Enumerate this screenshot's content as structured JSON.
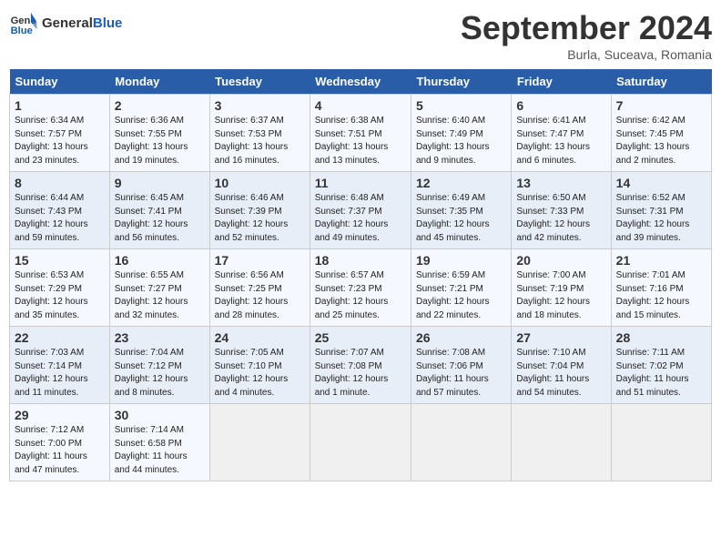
{
  "logo": {
    "text_general": "General",
    "text_blue": "Blue"
  },
  "header": {
    "title": "September 2024",
    "subtitle": "Burla, Suceava, Romania"
  },
  "weekdays": [
    "Sunday",
    "Monday",
    "Tuesday",
    "Wednesday",
    "Thursday",
    "Friday",
    "Saturday"
  ],
  "weeks": [
    [
      {
        "day": "1",
        "info": "Sunrise: 6:34 AM\nSunset: 7:57 PM\nDaylight: 13 hours\nand 23 minutes."
      },
      {
        "day": "2",
        "info": "Sunrise: 6:36 AM\nSunset: 7:55 PM\nDaylight: 13 hours\nand 19 minutes."
      },
      {
        "day": "3",
        "info": "Sunrise: 6:37 AM\nSunset: 7:53 PM\nDaylight: 13 hours\nand 16 minutes."
      },
      {
        "day": "4",
        "info": "Sunrise: 6:38 AM\nSunset: 7:51 PM\nDaylight: 13 hours\nand 13 minutes."
      },
      {
        "day": "5",
        "info": "Sunrise: 6:40 AM\nSunset: 7:49 PM\nDaylight: 13 hours\nand 9 minutes."
      },
      {
        "day": "6",
        "info": "Sunrise: 6:41 AM\nSunset: 7:47 PM\nDaylight: 13 hours\nand 6 minutes."
      },
      {
        "day": "7",
        "info": "Sunrise: 6:42 AM\nSunset: 7:45 PM\nDaylight: 13 hours\nand 2 minutes."
      }
    ],
    [
      {
        "day": "8",
        "info": "Sunrise: 6:44 AM\nSunset: 7:43 PM\nDaylight: 12 hours\nand 59 minutes."
      },
      {
        "day": "9",
        "info": "Sunrise: 6:45 AM\nSunset: 7:41 PM\nDaylight: 12 hours\nand 56 minutes."
      },
      {
        "day": "10",
        "info": "Sunrise: 6:46 AM\nSunset: 7:39 PM\nDaylight: 12 hours\nand 52 minutes."
      },
      {
        "day": "11",
        "info": "Sunrise: 6:48 AM\nSunset: 7:37 PM\nDaylight: 12 hours\nand 49 minutes."
      },
      {
        "day": "12",
        "info": "Sunrise: 6:49 AM\nSunset: 7:35 PM\nDaylight: 12 hours\nand 45 minutes."
      },
      {
        "day": "13",
        "info": "Sunrise: 6:50 AM\nSunset: 7:33 PM\nDaylight: 12 hours\nand 42 minutes."
      },
      {
        "day": "14",
        "info": "Sunrise: 6:52 AM\nSunset: 7:31 PM\nDaylight: 12 hours\nand 39 minutes."
      }
    ],
    [
      {
        "day": "15",
        "info": "Sunrise: 6:53 AM\nSunset: 7:29 PM\nDaylight: 12 hours\nand 35 minutes."
      },
      {
        "day": "16",
        "info": "Sunrise: 6:55 AM\nSunset: 7:27 PM\nDaylight: 12 hours\nand 32 minutes."
      },
      {
        "day": "17",
        "info": "Sunrise: 6:56 AM\nSunset: 7:25 PM\nDaylight: 12 hours\nand 28 minutes."
      },
      {
        "day": "18",
        "info": "Sunrise: 6:57 AM\nSunset: 7:23 PM\nDaylight: 12 hours\nand 25 minutes."
      },
      {
        "day": "19",
        "info": "Sunrise: 6:59 AM\nSunset: 7:21 PM\nDaylight: 12 hours\nand 22 minutes."
      },
      {
        "day": "20",
        "info": "Sunrise: 7:00 AM\nSunset: 7:19 PM\nDaylight: 12 hours\nand 18 minutes."
      },
      {
        "day": "21",
        "info": "Sunrise: 7:01 AM\nSunset: 7:16 PM\nDaylight: 12 hours\nand 15 minutes."
      }
    ],
    [
      {
        "day": "22",
        "info": "Sunrise: 7:03 AM\nSunset: 7:14 PM\nDaylight: 12 hours\nand 11 minutes."
      },
      {
        "day": "23",
        "info": "Sunrise: 7:04 AM\nSunset: 7:12 PM\nDaylight: 12 hours\nand 8 minutes."
      },
      {
        "day": "24",
        "info": "Sunrise: 7:05 AM\nSunset: 7:10 PM\nDaylight: 12 hours\nand 4 minutes."
      },
      {
        "day": "25",
        "info": "Sunrise: 7:07 AM\nSunset: 7:08 PM\nDaylight: 12 hours\nand 1 minute."
      },
      {
        "day": "26",
        "info": "Sunrise: 7:08 AM\nSunset: 7:06 PM\nDaylight: 11 hours\nand 57 minutes."
      },
      {
        "day": "27",
        "info": "Sunrise: 7:10 AM\nSunset: 7:04 PM\nDaylight: 11 hours\nand 54 minutes."
      },
      {
        "day": "28",
        "info": "Sunrise: 7:11 AM\nSunset: 7:02 PM\nDaylight: 11 hours\nand 51 minutes."
      }
    ],
    [
      {
        "day": "29",
        "info": "Sunrise: 7:12 AM\nSunset: 7:00 PM\nDaylight: 11 hours\nand 47 minutes."
      },
      {
        "day": "30",
        "info": "Sunrise: 7:14 AM\nSunset: 6:58 PM\nDaylight: 11 hours\nand 44 minutes."
      },
      {
        "day": "",
        "info": ""
      },
      {
        "day": "",
        "info": ""
      },
      {
        "day": "",
        "info": ""
      },
      {
        "day": "",
        "info": ""
      },
      {
        "day": "",
        "info": ""
      }
    ]
  ]
}
